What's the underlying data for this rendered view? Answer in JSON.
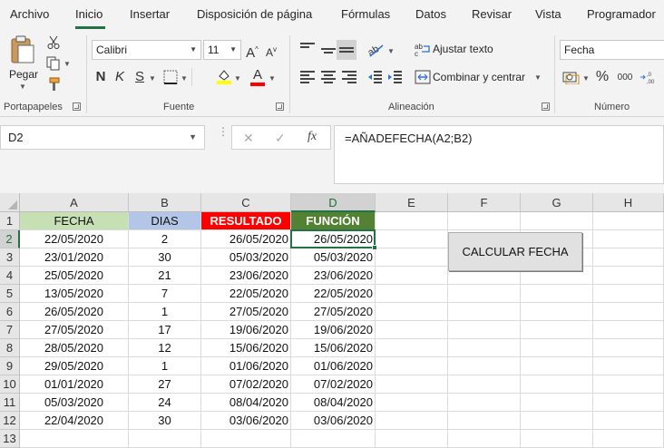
{
  "tabs": [
    "Archivo",
    "Inicio",
    "Insertar",
    "Disposición de página",
    "Fórmulas",
    "Datos",
    "Revisar",
    "Vista",
    "Programador"
  ],
  "ribbon": {
    "clipboard": {
      "paste_label": "Pegar",
      "group_label": "Portapapeles"
    },
    "font": {
      "name": "Calibri",
      "size": "11",
      "grow_glyph": "A",
      "shrink_glyph": "A",
      "bold": "N",
      "italic": "K",
      "underline": "S",
      "font_color_glyph": "A",
      "group_label": "Fuente"
    },
    "alignment": {
      "wrap_label": "Ajustar texto",
      "merge_label": "Combinar y centrar",
      "group_label": "Alineación"
    },
    "number": {
      "format": "Fecha",
      "percent": "%",
      "thousands": "000",
      "group_label": "Número"
    }
  },
  "formula_bar": {
    "name_box": "D2",
    "cancel_glyph": "✕",
    "enter_glyph": "✓",
    "fx_glyph": "fx",
    "formula": "=AÑADEFECHA(A2;B2)"
  },
  "grid": {
    "columns": [
      "A",
      "B",
      "C",
      "D",
      "E",
      "F",
      "G",
      "H"
    ],
    "rows": [
      "1",
      "2",
      "3",
      "4",
      "5",
      "6",
      "7",
      "8",
      "9",
      "10",
      "11",
      "12",
      "13"
    ],
    "headers": {
      "a": "FECHA",
      "b": "DIAS",
      "c": "RESULTADO",
      "d": "FUNCIÓN"
    },
    "header_colors": {
      "a": "#c6e0b4",
      "b": "#b4c6e7",
      "c": "#ff0000",
      "d": "#548235"
    },
    "data": [
      [
        "22/05/2020",
        "2",
        "26/05/2020",
        "26/05/2020"
      ],
      [
        "23/01/2020",
        "30",
        "05/03/2020",
        "05/03/2020"
      ],
      [
        "25/05/2020",
        "21",
        "23/06/2020",
        "23/06/2020"
      ],
      [
        "13/05/2020",
        "7",
        "22/05/2020",
        "22/05/2020"
      ],
      [
        "26/05/2020",
        "1",
        "27/05/2020",
        "27/05/2020"
      ],
      [
        "27/05/2020",
        "17",
        "19/06/2020",
        "19/06/2020"
      ],
      [
        "28/05/2020",
        "12",
        "15/06/2020",
        "15/06/2020"
      ],
      [
        "29/05/2020",
        "1",
        "01/06/2020",
        "01/06/2020"
      ],
      [
        "01/01/2020",
        "27",
        "07/02/2020",
        "07/02/2020"
      ],
      [
        "05/03/2020",
        "24",
        "08/04/2020",
        "08/04/2020"
      ],
      [
        "22/04/2020",
        "30",
        "03/06/2020",
        "03/06/2020"
      ]
    ],
    "selected_cell": "D2"
  },
  "button": {
    "label": "CALCULAR FECHA"
  },
  "accent_color": "#217346"
}
